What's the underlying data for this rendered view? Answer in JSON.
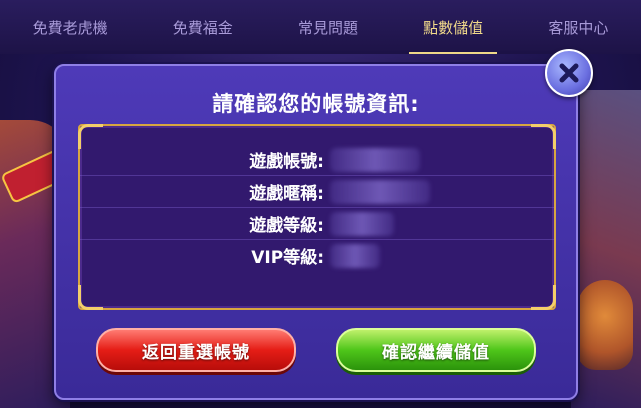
{
  "nav": {
    "items": [
      {
        "label": "免費老虎機"
      },
      {
        "label": "免費福金"
      },
      {
        "label": "常見問題"
      },
      {
        "label": "點數儲值"
      },
      {
        "label": "客服中心"
      }
    ],
    "active_index": 3
  },
  "dialog": {
    "title": "請確認您的帳號資訊:",
    "fields": [
      {
        "label": "遊戲帳號:",
        "value": ""
      },
      {
        "label": "遊戲暱稱:",
        "value": ""
      },
      {
        "label": "遊戲等級:",
        "value": ""
      },
      {
        "label": "VIP等級:",
        "value": ""
      }
    ],
    "back_button": "返回重選帳號",
    "confirm_button": "確認繼續儲值",
    "close_icon": "close-icon"
  },
  "colors": {
    "accent_gold": "#f0d98a",
    "dialog_bg": "#4e3ab8",
    "back_red": "#e51d16",
    "confirm_green": "#4fc61a"
  }
}
